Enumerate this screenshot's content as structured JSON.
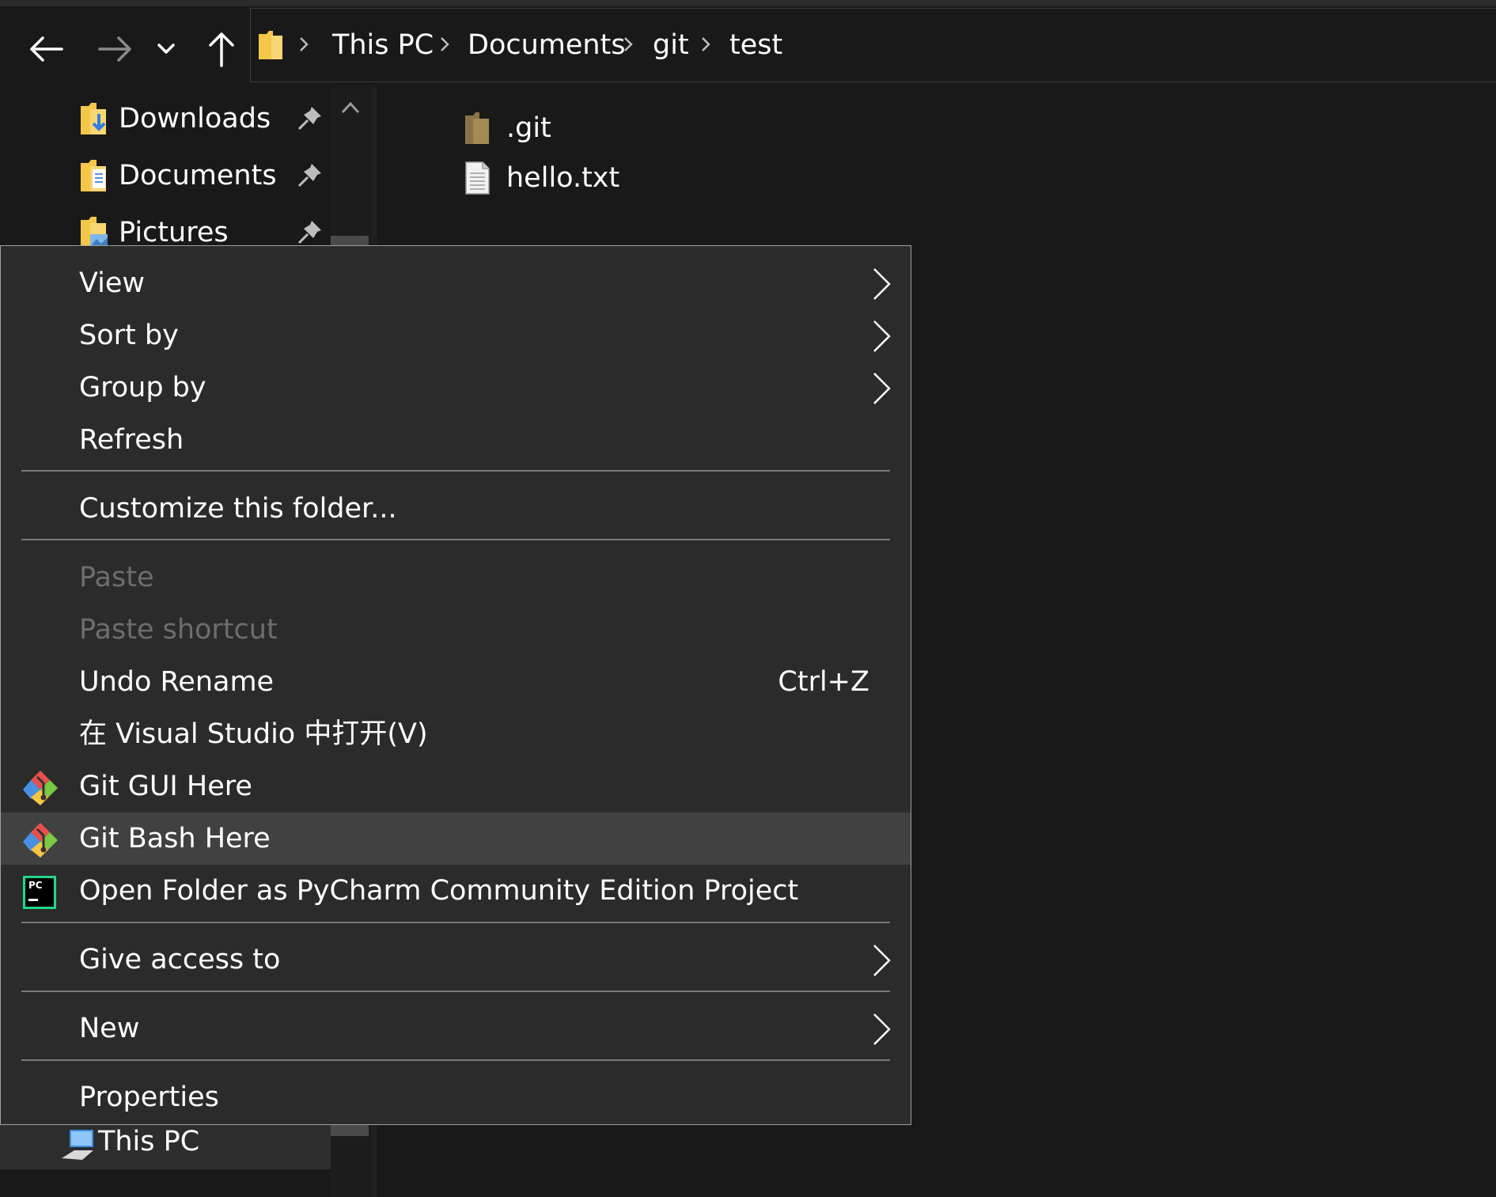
{
  "address": {
    "crumbs": [
      "This PC",
      "Documents",
      "git",
      "test"
    ]
  },
  "nav": {
    "quick_access": [
      {
        "label": "Downloads",
        "icon": "downloads-folder-icon"
      },
      {
        "label": "Documents",
        "icon": "documents-folder-icon"
      },
      {
        "label": "Pictures",
        "icon": "pictures-folder-icon"
      }
    ],
    "this_pc_label": "This PC"
  },
  "files": [
    {
      "name": ".git",
      "icon": "folder-icon"
    },
    {
      "name": "hello.txt",
      "icon": "text-file-icon"
    }
  ],
  "menu": {
    "view": "View",
    "sort_by": "Sort by",
    "group_by": "Group by",
    "refresh": "Refresh",
    "customize": "Customize this folder...",
    "paste": "Paste",
    "paste_shortcut": "Paste shortcut",
    "undo_rename": "Undo Rename",
    "undo_rename_shortcut": "Ctrl+Z",
    "open_vs": "在 Visual Studio 中打开(V)",
    "git_gui": "Git GUI Here",
    "git_bash": "Git Bash Here",
    "pycharm": "Open Folder as PyCharm Community Edition Project",
    "pycharm_badge": "PC",
    "give_access": "Give access to",
    "new": "New",
    "properties": "Properties"
  },
  "colors": {
    "background": "#191919",
    "menu_background": "#2b2b2b",
    "menu_hover": "#414141",
    "folder_yellow": "#f5c748",
    "disabled_text": "#6d6d6d"
  }
}
